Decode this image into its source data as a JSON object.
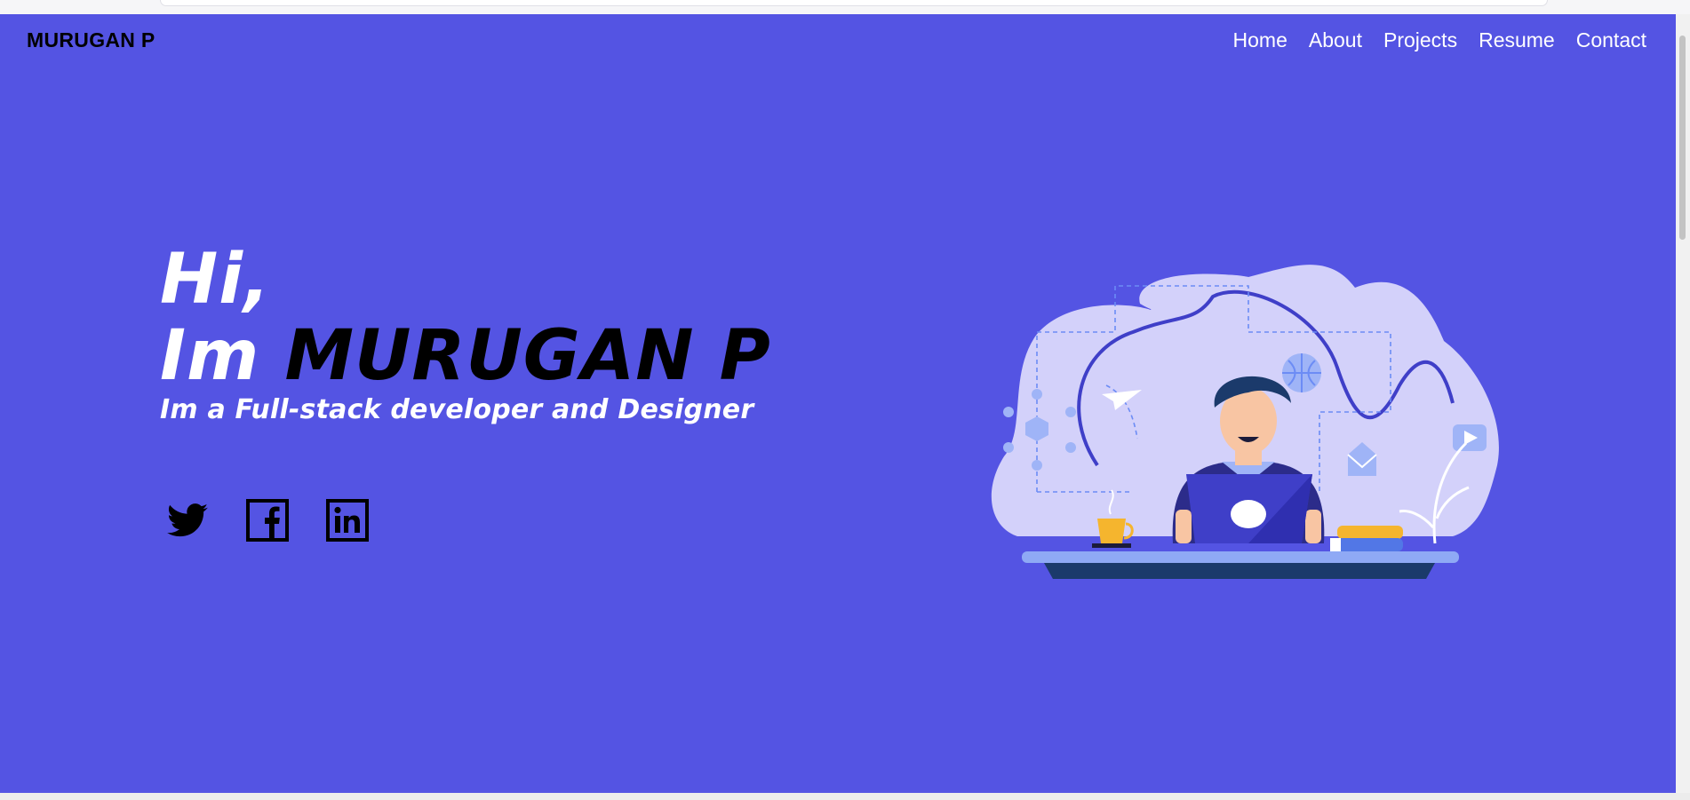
{
  "header": {
    "brand": "MURUGAN P",
    "nav": [
      "Home",
      "About",
      "Projects",
      "Resume",
      "Contact"
    ]
  },
  "hero": {
    "greeting": "Hi,",
    "intro_prefix": "Im",
    "name": "MURUGAN P",
    "tagline": "Im a Full-stack developer and Designer"
  },
  "socials": [
    {
      "icon": "twitter-icon"
    },
    {
      "icon": "facebook-icon"
    },
    {
      "icon": "linkedin-icon"
    }
  ],
  "colors": {
    "background": "#5454e3",
    "text": "#ffffff",
    "accent": "#000000"
  }
}
